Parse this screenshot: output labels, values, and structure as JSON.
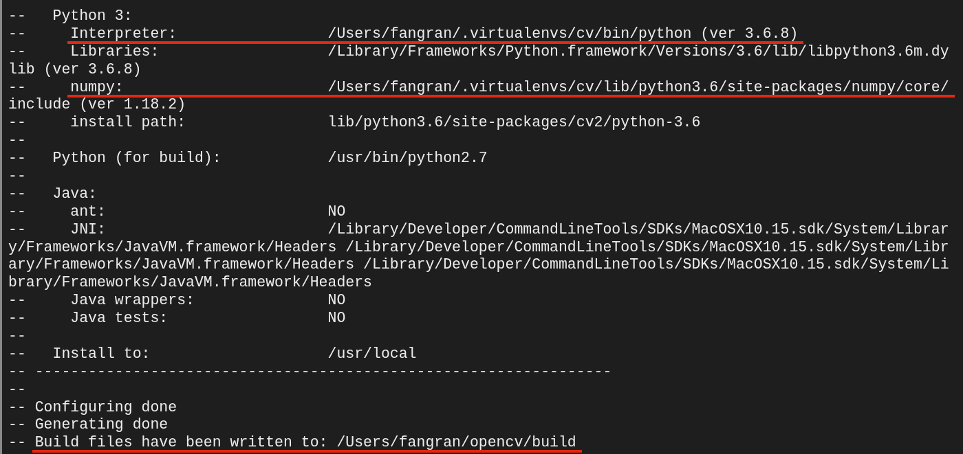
{
  "terminal": {
    "lines": [
      {
        "text": "--   Python 3:",
        "underlined": false
      },
      {
        "text": "--     Interpreter:                 /Users/fangran/.virtualenvs/cv/bin/python (ver 3.6.8)",
        "underlined": true
      },
      {
        "text": "--     Libraries:                   /Library/Frameworks/Python.framework/Versions/3.6/lib/libpython3.6m.dy",
        "underlined": false
      },
      {
        "text": "lib (ver 3.6.8)",
        "underlined": false
      },
      {
        "text": "--     numpy:                       /Users/fangran/.virtualenvs/cv/lib/python3.6/site-packages/numpy/core/",
        "underlined": true
      },
      {
        "text": "include (ver 1.18.2)",
        "underlined": false
      },
      {
        "text": "--     install path:                lib/python3.6/site-packages/cv2/python-3.6",
        "underlined": false
      },
      {
        "text": "--",
        "underlined": false
      },
      {
        "text": "--   Python (for build):            /usr/bin/python2.7",
        "underlined": false
      },
      {
        "text": "--",
        "underlined": false
      },
      {
        "text": "--   Java:",
        "underlined": false
      },
      {
        "text": "--     ant:                         NO",
        "underlined": false
      },
      {
        "text": "--     JNI:                         /Library/Developer/CommandLineTools/SDKs/MacOSX10.15.sdk/System/Librar",
        "underlined": false
      },
      {
        "text": "y/Frameworks/JavaVM.framework/Headers /Library/Developer/CommandLineTools/SDKs/MacOSX10.15.sdk/System/Libr",
        "underlined": false
      },
      {
        "text": "ary/Frameworks/JavaVM.framework/Headers /Library/Developer/CommandLineTools/SDKs/MacOSX10.15.sdk/System/Li",
        "underlined": false
      },
      {
        "text": "brary/Frameworks/JavaVM.framework/Headers",
        "underlined": false
      },
      {
        "text": "--     Java wrappers:               NO",
        "underlined": false
      },
      {
        "text": "--     Java tests:                  NO",
        "underlined": false
      },
      {
        "text": "--",
        "underlined": false
      },
      {
        "text": "--   Install to:                    /usr/local",
        "underlined": false
      },
      {
        "text": "-- -----------------------------------------------------------------",
        "underlined": false
      },
      {
        "text": "--",
        "underlined": false
      },
      {
        "text": "-- Configuring done",
        "underlined": false
      },
      {
        "text": "-- Generating done",
        "underlined": false
      },
      {
        "text": "-- Build files have been written to: /Users/fangran/opencv/build",
        "underlined": true
      }
    ]
  }
}
